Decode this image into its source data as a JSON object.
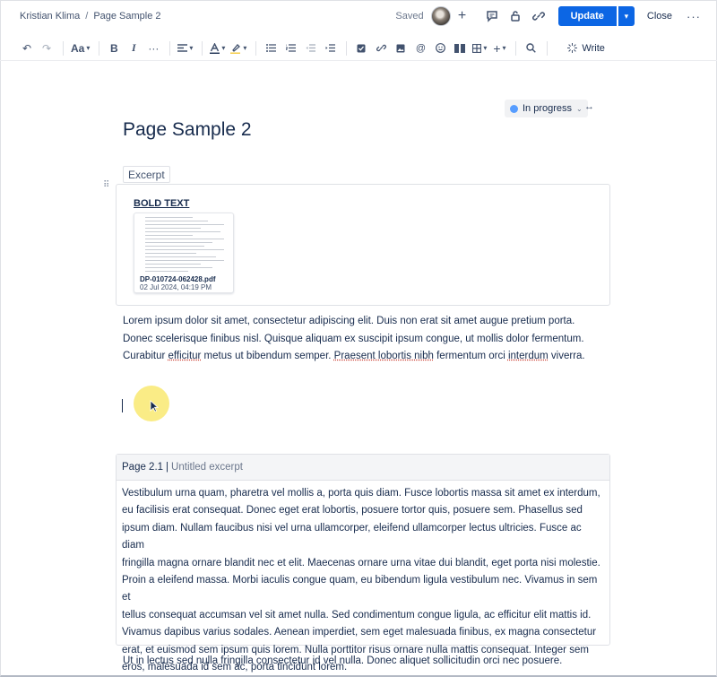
{
  "breadcrumb": {
    "space": "Kristian Klima",
    "separator": "/",
    "page": "Page Sample 2"
  },
  "header": {
    "saved_label": "Saved",
    "update_label": "Update",
    "close_label": "Close",
    "more_label": "···",
    "accent_color": "#0c66e4"
  },
  "toolbar": {
    "undo": "↶",
    "redo": "↷",
    "text_style": "Aa",
    "bold": "B",
    "italic": "I",
    "more_format": "···",
    "write_label": "Write"
  },
  "status": {
    "label": "In progress",
    "dot_color": "#579dff"
  },
  "page": {
    "title": "Page Sample 2"
  },
  "excerpt": {
    "tag_label": "Excerpt",
    "bold_text": "BOLD TEXT",
    "file": {
      "name": "DP-010724-062428.pdf",
      "date": "02 Jul 2024, 04:19 PM"
    }
  },
  "paragraph": {
    "line1": "Lorem ipsum dolor sit amet, consectetur adipiscing elit. Duis non erat sit amet augue pretium porta.",
    "line2": "Donec scelerisque finibus nisl. Quisque aliquam ex suscipit ipsum congue, ut mollis dolor fermentum.",
    "line3_a": "Curabitur ",
    "line3_w1": "efficitur",
    "line3_b": " metus ut bibendum semper. ",
    "line3_w2": "Praesent lobortis nibh",
    "line3_c": " fermentum orci ",
    "line3_w3": "interdum",
    "line3_d": " viverra."
  },
  "include": {
    "page_label": "Page 2.1",
    "separator": "|",
    "subtitle": "Untitled excerpt",
    "lines": [
      "Vestibulum urna quam, pharetra vel mollis a, porta quis diam. Fusce lobortis massa sit amet ex interdum,",
      "eu facilisis erat consequat. Donec eget erat lobortis, posuere tortor quis, posuere sem. Phasellus sed",
      "ipsum diam. Nullam faucibus nisi vel urna ullamcorper, eleifend ullamcorper lectus ultricies. Fusce ac diam",
      "fringilla magna ornare blandit nec et elit. Maecenas ornare urna vitae dui blandit, eget porta nisi molestie.",
      "Proin a eleifend massa. Morbi iaculis congue quam, eu bibendum ligula vestibulum nec. Vivamus in sem et",
      "tellus consequat accumsan vel sit amet nulla. Sed condimentum congue ligula, ac efficitur elit mattis id.",
      "Vivamus dapibus varius sodales. Aenean imperdiet, sem eget malesuada finibus, ex magna consectetur",
      "erat, et euismod sem ipsum quis lorem. Nulla porttitor risus ornare nulla mattis consequat. Integer sem",
      "eros, malesuada id sem ac, porta tincidunt lorem."
    ]
  },
  "bottom_paragraph": "Ut in lectus sed nulla fringilla consectetur id vel nulla. Donec aliquet sollicitudin orci nec posuere."
}
